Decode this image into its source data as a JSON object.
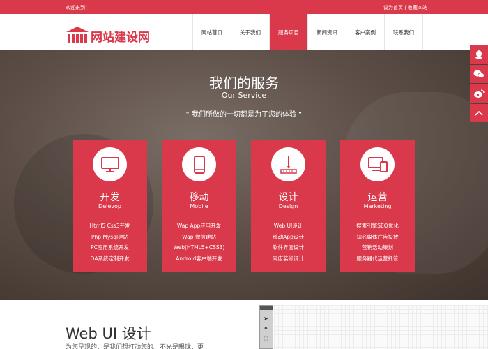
{
  "topbar": {
    "welcome": "欢迎来到！",
    "set_home": "设为首页",
    "separator": "|",
    "bookmark": "收藏本站"
  },
  "header": {
    "logo_text": "网站建设网",
    "nav": [
      "网站首页",
      "关于我们",
      "服务项目",
      "新闻资讯",
      "客户案例",
      "联系我们"
    ],
    "active_nav_index": 2
  },
  "banner": {
    "title": "我们的服务",
    "subtitle": "Our Service",
    "slogan": "“  我们所做的一切都是为了您的体验  “"
  },
  "cards": [
    {
      "icon": "monitor-icon",
      "cn": "开发",
      "en": "Delevop",
      "items": [
        "Html5 Css3开发",
        "Php Mysql建站",
        "PC应用系统开发",
        "OA系统定制开发"
      ]
    },
    {
      "icon": "mobile-icon",
      "cn": "移动",
      "en": "Mobile",
      "items": [
        "Wap App应用开发",
        "Wap 微信建站",
        "Web(HTML5+CSS3)",
        "Android客户端开发"
      ]
    },
    {
      "icon": "design-ruler-icon",
      "cn": "设计",
      "en": "Design",
      "items": [
        "Web UI设计",
        "移动App设计",
        "软件界面设计",
        "网店装修设计"
      ]
    },
    {
      "icon": "devices-icon",
      "cn": "运营",
      "en": "Marketing",
      "items": [
        "搜索引擎SEO优化",
        "知名媒体广告投放",
        "营销活动策划",
        "服务器代运营托管"
      ]
    }
  ],
  "float_bar": [
    "qq-icon",
    "wechat-icon",
    "weibo-icon",
    "back-to-top-icon"
  ],
  "bottom": {
    "title": "Web UI 设计",
    "text": "为您呈现的，是我们想打动您的。不光是眼球，更"
  },
  "colors": {
    "brand": "#d9394a",
    "banner_dark": "#4a3d37"
  }
}
